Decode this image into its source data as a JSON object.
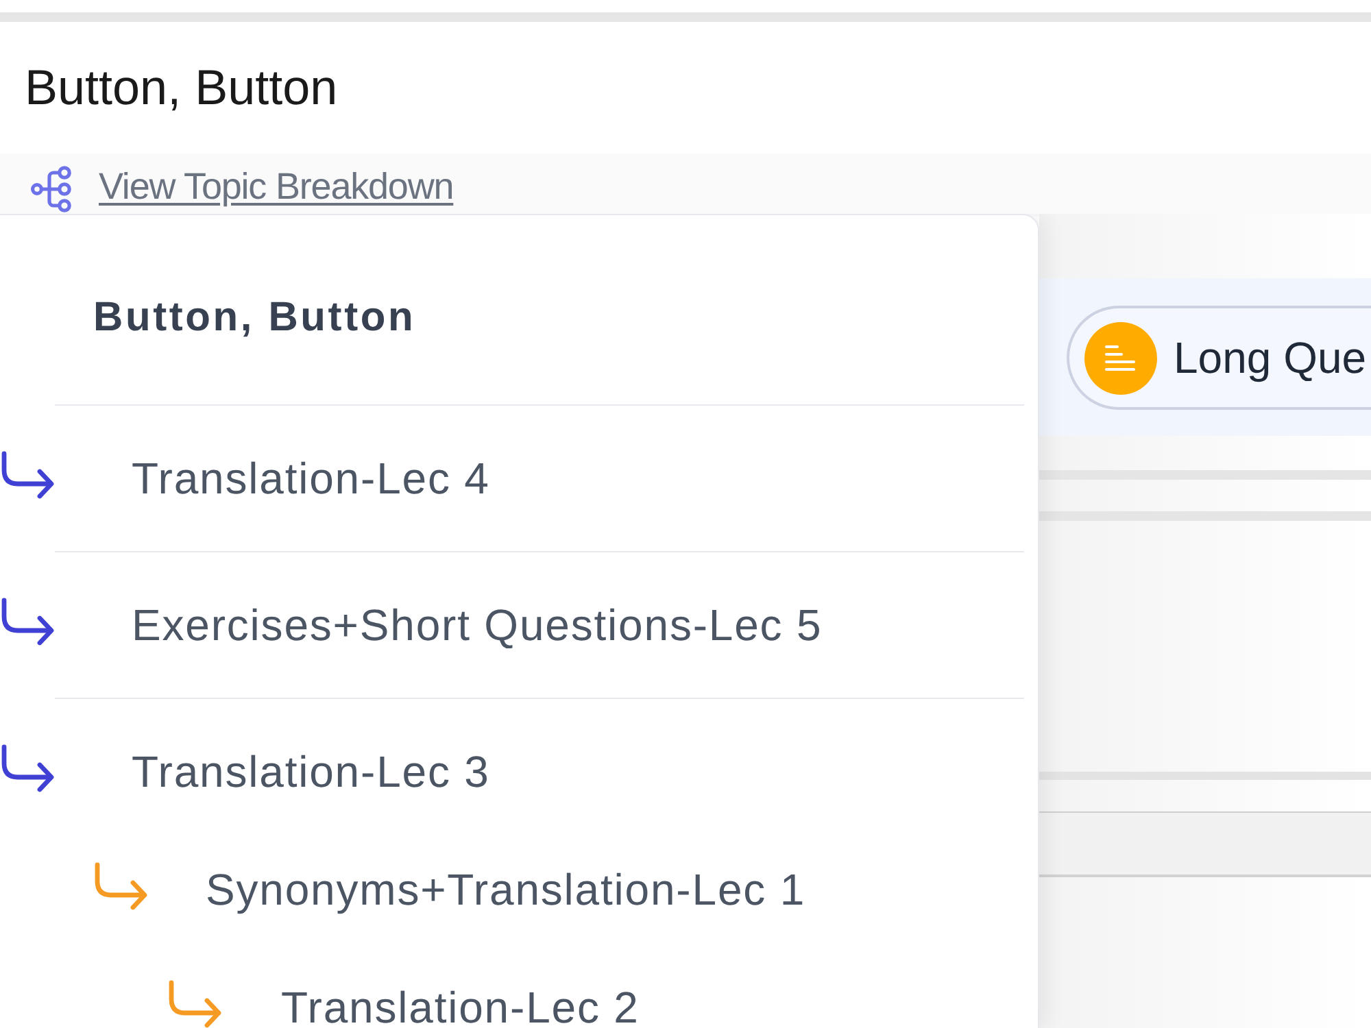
{
  "page": {
    "title": "Button, Button",
    "topic_link": {
      "label": "View Topic Breakdown"
    }
  },
  "topic_breakdown": {
    "heading": "Button, Button",
    "items": [
      {
        "label": "Translation-Lec 4"
      },
      {
        "label": "Exercises+Short Questions-Lec 5"
      },
      {
        "label": "Translation-Lec 3",
        "children": [
          {
            "label": "Synonyms+Translation-Lec 1",
            "children": [
              {
                "label": "Translation-Lec 2"
              }
            ]
          }
        ]
      }
    ]
  },
  "question_types": [
    {
      "label": "Long Que"
    }
  ]
}
